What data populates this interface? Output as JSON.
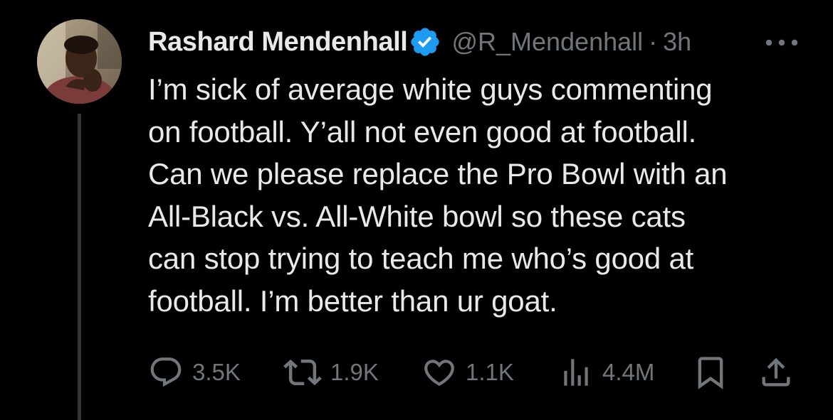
{
  "tweet": {
    "display_name": "Rashard Mendenhall",
    "handle": "@R_Mendenhall",
    "separator": "·",
    "time": "3h",
    "text": "I’m sick of average white guys commenting\non football. Y’all not even good at football.\nCan we please replace the Pro Bowl with an\nAll-Black vs. All-White bowl so these cats\ncan stop trying to teach me who’s good at\nfootball. I’m better than ur goat."
  },
  "actions": {
    "replies": "3.5K",
    "retweets": "1.9K",
    "likes": "1.1K",
    "views": "4.4M"
  },
  "icons": {
    "verified": "verified-badge-icon",
    "more": "more-icon",
    "reply": "reply-icon",
    "retweet": "retweet-icon",
    "like": "heart-icon",
    "views": "views-icon",
    "bookmark": "bookmark-icon",
    "share": "share-icon"
  },
  "colors": {
    "background": "#000000",
    "text_primary": "#e7e9ea",
    "text_secondary": "#71767b",
    "verified": "#1d9bf0",
    "thread_line": "#333639"
  }
}
